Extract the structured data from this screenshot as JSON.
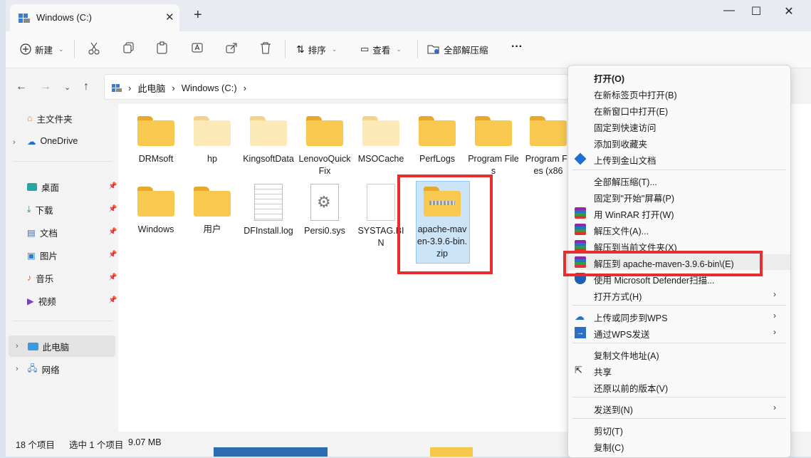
{
  "window": {
    "tab_title": "Windows (C:)",
    "new_tab": "+",
    "minimize": "—",
    "maximize": "☐",
    "close": "✕"
  },
  "toolbar": {
    "new": "新建",
    "sort": "排序",
    "view": "查看",
    "extract_all": "全部解压缩",
    "more": "···"
  },
  "address": {
    "crumbs": [
      "此电脑",
      "Windows (C:)"
    ]
  },
  "sidebar": {
    "home": "主文件夹",
    "onedrive": "OneDrive",
    "quick": [
      "桌面",
      "下载",
      "文档",
      "图片",
      "音乐",
      "视频"
    ],
    "this_pc": "此电脑",
    "network": "网络"
  },
  "files": {
    "row1": [
      "DRMsoft",
      "hp",
      "KingsoftData",
      "LenovoQuickFix",
      "MSOCache",
      "PerfLogs",
      "Program Files",
      "Program Files (x86"
    ],
    "row2": [
      "Windows",
      "用户",
      "DFInstall.log",
      "Persi0.sys",
      "SYSTAG.BIN",
      "apache-maven-3.9.6-bin.zip"
    ]
  },
  "status": {
    "count": "18 个项目",
    "selected": "选中 1 个项目",
    "size": "9.07 MB"
  },
  "menu": {
    "items": [
      "打开(O)",
      "在新标签页中打开(B)",
      "在新窗口中打开(E)",
      "固定到快速访问",
      "添加到收藏夹",
      "上传到金山文档",
      "全部解压缩(T)...",
      "固定到\"开始\"屏幕(P)",
      "用 WinRAR 打开(W)",
      "解压文件(A)...",
      "解压到当前文件夹(X)",
      "解压到 apache-maven-3.9.6-bin\\(E)",
      "使用 Microsoft Defender扫描...",
      "打开方式(H)",
      "上传或同步到WPS",
      "通过WPS发送",
      "复制文件地址(A)",
      "共享",
      "还原以前的版本(V)",
      "发送到(N)",
      "剪切(T)",
      "复制(C)"
    ]
  }
}
